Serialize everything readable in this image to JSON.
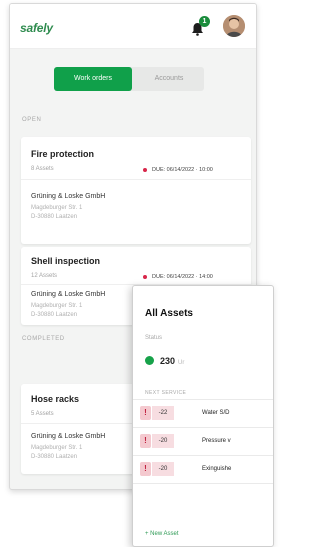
{
  "app": {
    "logo": "safely",
    "notification_count": "1"
  },
  "tabs": [
    {
      "label": "Work orders",
      "active": true
    },
    {
      "label": "Accounts",
      "active": false
    }
  ],
  "sections": {
    "open": "OPEN",
    "completed": "COMPLETED"
  },
  "open_orders": [
    {
      "title": "Fire protection",
      "assets": "8 Assets",
      "due": "DUE: 06/14/2022 · 10:00",
      "company": "Grüning & Loske GmbH",
      "address_line1": "Magdeburger Str. 1",
      "address_line2": "D-30880 Laatzen"
    },
    {
      "title": "Shell inspection",
      "assets": "12 Assets",
      "due": "DUE: 06/14/2022 · 14:00",
      "company": "Grüning & Loske GmbH",
      "address_line1": "Magdeburger Str. 1",
      "address_line2": "D-30880 Laatzen"
    }
  ],
  "completed_orders": [
    {
      "title": "Hose racks",
      "assets": "5 Assets",
      "company": "Grüning & Loske GmbH",
      "address_line1": "Magdeburger Str. 1",
      "address_line2": "D-30880 Laatzen"
    }
  ],
  "all_assets": {
    "title": "All Assets",
    "status_label": "Status",
    "status_value": "230",
    "status_unit": "Ur",
    "next_service_label": "NEXT SERVICE",
    "rows": [
      {
        "days": "-22",
        "name": "Water S/D"
      },
      {
        "days": "-20",
        "name": "Pressure v"
      },
      {
        "days": "-20",
        "name": "Exinguishe"
      }
    ],
    "new_asset": "+ New Asset"
  },
  "colors": {
    "brand_green": "#10a04a",
    "alert_red": "#d8264a"
  }
}
